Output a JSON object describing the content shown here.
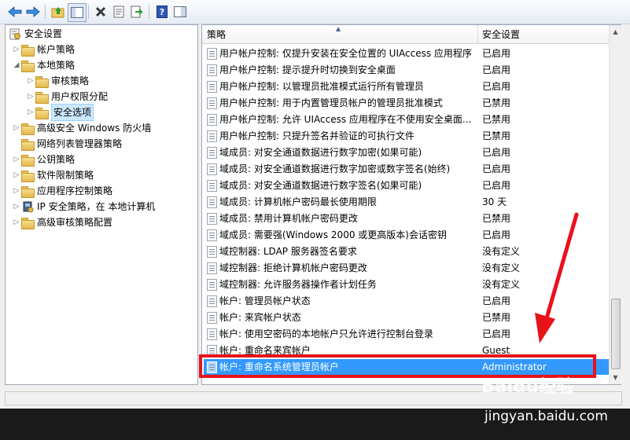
{
  "toolbar": {
    "icons": [
      "back-icon",
      "forward-icon",
      "up-folder-icon",
      "show-tree-icon",
      "delete-icon",
      "properties-icon",
      "export-icon",
      "help-icon",
      "show-hide-icon"
    ]
  },
  "tree": {
    "root": "安全设置",
    "items": [
      {
        "label": "帐户策略",
        "level": 1,
        "expanded": false
      },
      {
        "label": "本地策略",
        "level": 1,
        "expanded": true
      },
      {
        "label": "审核策略",
        "level": 2,
        "expanded": false
      },
      {
        "label": "用户权限分配",
        "level": 2,
        "expanded": false
      },
      {
        "label": "安全选项",
        "level": 2,
        "expanded": false,
        "selected": true
      },
      {
        "label": "高级安全 Windows 防火墙",
        "level": 1,
        "expanded": false
      },
      {
        "label": "网络列表管理器策略",
        "level": 1,
        "expanded": null
      },
      {
        "label": "公钥策略",
        "level": 1,
        "expanded": false
      },
      {
        "label": "软件限制策略",
        "level": 1,
        "expanded": false
      },
      {
        "label": "应用程序控制策略",
        "level": 1,
        "expanded": false
      },
      {
        "label": "IP 安全策略，在 本地计算机",
        "level": 1,
        "expanded": false
      },
      {
        "label": "高级审核策略配置",
        "level": 1,
        "expanded": false
      }
    ]
  },
  "list": {
    "columns": [
      "策略",
      "安全设置"
    ],
    "rows": [
      {
        "policy": "用户帐户控制: 仅提升安装在安全位置的 UIAccess 应用程序",
        "setting": "已启用"
      },
      {
        "policy": "用户帐户控制: 提示提升时切换到安全桌面",
        "setting": "已启用"
      },
      {
        "policy": "用户帐户控制: 以管理员批准模式运行所有管理员",
        "setting": "已启用"
      },
      {
        "policy": "用户帐户控制: 用于内置管理员帐户的管理员批准模式",
        "setting": "已禁用"
      },
      {
        "policy": "用户帐户控制: 允许 UIAccess 应用程序在不使用安全桌面...",
        "setting": "已禁用"
      },
      {
        "policy": "用户帐户控制: 只提升签名并验证的可执行文件",
        "setting": "已禁用"
      },
      {
        "policy": "域成员: 对安全通道数据进行数字加密(如果可能)",
        "setting": "已启用"
      },
      {
        "policy": "域成员: 对安全通道数据进行数字加密或数字签名(始终)",
        "setting": "已启用"
      },
      {
        "policy": "域成员: 对安全通道数据进行数字签名(如果可能)",
        "setting": "已启用"
      },
      {
        "policy": "域成员: 计算机帐户密码最长使用期限",
        "setting": "30 天"
      },
      {
        "policy": "域成员: 禁用计算机帐户密码更改",
        "setting": "已禁用"
      },
      {
        "policy": "域成员: 需要强(Windows 2000 或更高版本)会话密钥",
        "setting": "已启用"
      },
      {
        "policy": "域控制器: LDAP 服务器签名要求",
        "setting": "没有定义"
      },
      {
        "policy": "域控制器: 拒绝计算机帐户密码更改",
        "setting": "没有定义"
      },
      {
        "policy": "域控制器: 允许服务器操作者计划任务",
        "setting": "没有定义"
      },
      {
        "policy": "帐户: 管理员帐户状态",
        "setting": "已启用"
      },
      {
        "policy": "帐户: 来宾帐户状态",
        "setting": "已禁用"
      },
      {
        "policy": "帐户: 使用空密码的本地帐户只允许进行控制台登录",
        "setting": "已启用"
      },
      {
        "policy": "帐户: 重命名来宾帐户",
        "setting": "Guest"
      },
      {
        "policy": "帐户: 重命名系统管理员帐户",
        "setting": "Administrator",
        "selected": true
      }
    ]
  },
  "watermark": {
    "brand": "Baidu经验",
    "url": "jingyan.baidu.com"
  },
  "colors": {
    "selection": "#3399ff",
    "highlight_box": "#e8121b"
  }
}
